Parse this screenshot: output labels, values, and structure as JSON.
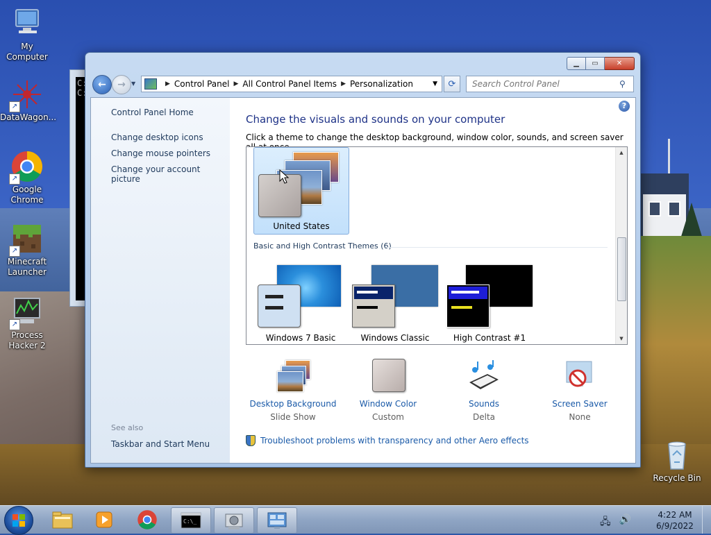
{
  "desktop": {
    "icons": [
      {
        "label": "My Computer",
        "icon": "computer-icon"
      },
      {
        "label": "DataWagon...",
        "icon": "datawagon-icon"
      },
      {
        "label": "Google Chrome",
        "icon": "chrome-icon"
      },
      {
        "label": "Minecraft Launcher",
        "icon": "minecraft-icon"
      },
      {
        "label": "Process Hacker 2",
        "icon": "process-hacker-icon"
      },
      {
        "label": "Recycle Bin",
        "icon": "recycle-bin-icon"
      }
    ],
    "cmd_text": "C:\nC:"
  },
  "window": {
    "address": {
      "crumbs": [
        "Control Panel",
        "All Control Panel Items",
        "Personalization"
      ]
    },
    "search": {
      "placeholder": "Search Control Panel"
    },
    "left_pane": {
      "home": "Control Panel Home",
      "links": [
        "Change desktop icons",
        "Change mouse pointers",
        "Change your account picture"
      ],
      "see_also": "See also",
      "see_also_links": [
        "Taskbar and Start Menu"
      ]
    },
    "heading": "Change the visuals and sounds on your computer",
    "subheading": "Click a theme to change the desktop background, window color, sounds, and screen saver all at once.",
    "themes": {
      "top": [
        {
          "label": "United States",
          "selected": true
        }
      ],
      "group_title": "Basic and High Contrast Themes (6)",
      "basic": [
        {
          "label": "Windows 7 Basic"
        },
        {
          "label": "Windows Classic"
        },
        {
          "label": "High Contrast #1"
        }
      ]
    },
    "settings": [
      {
        "label": "Desktop Background",
        "value": "Slide Show",
        "icon": "desktop-background-icon"
      },
      {
        "label": "Window Color",
        "value": "Custom",
        "icon": "window-color-icon"
      },
      {
        "label": "Sounds",
        "value": "Delta",
        "icon": "sounds-icon"
      },
      {
        "label": "Screen Saver",
        "value": "None",
        "icon": "screen-saver-icon"
      }
    ],
    "troubleshoot": "Troubleshoot problems with transparency and other Aero effects"
  },
  "taskbar": {
    "pinned": [
      "file-explorer-icon",
      "media-player-icon",
      "chrome-icon",
      "cmd-icon",
      "control-panel-tool-icon",
      "personalization-icon"
    ],
    "time": "4:22 AM",
    "date": "6/9/2022"
  },
  "colors": {
    "link": "#1a5aa8",
    "heading": "#1e3287",
    "selection": "#c2e0fb"
  }
}
